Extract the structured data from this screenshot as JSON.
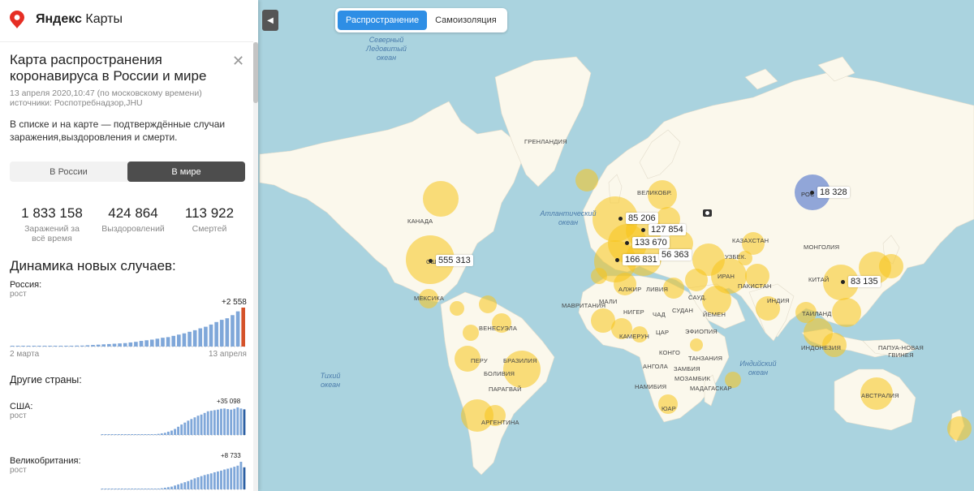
{
  "brand": {
    "name_bold": "Яндекс",
    "name": "Карты",
    "icon": "yandex-maps-pin-icon"
  },
  "panel": {
    "title": "Карта распространения коронавируса в России и мире",
    "close_icon": "✕",
    "date": "13 апреля 2020,10:47 (по московскому времени)",
    "sources": "источники: Роспотребнадзор,JHU",
    "description": "В списке и на карте — подтверждённые случаи заражения,выздоровления и смерти.",
    "segment": {
      "russia": "В России",
      "world": "В мире",
      "selected": "world"
    },
    "stats": [
      {
        "value": "1 833 158",
        "label": "Заражений за всё время"
      },
      {
        "value": "424 864",
        "label": "Выздоровлений"
      },
      {
        "value": "113 922",
        "label": "Смертей"
      }
    ],
    "dynamics_title": "Динамика новых случаев:",
    "other_countries": "Другие страны:"
  },
  "chart_data": [
    {
      "type": "bar",
      "label": "Россия:",
      "sublabel": "рост",
      "last_value_label": "+2 558",
      "x_start": "2 марта",
      "x_end": "13 апреля",
      "color": "#7fa7d9",
      "highlight_color": "#d4522a",
      "values": [
        0,
        0,
        0,
        0,
        0,
        0,
        0,
        0,
        1,
        1,
        1,
        2,
        3,
        3,
        4,
        5,
        6,
        7,
        8,
        9,
        10,
        11,
        13,
        15,
        18,
        20,
        22,
        25,
        28,
        30,
        34,
        38,
        42,
        47,
        52,
        58,
        63,
        70,
        78,
        85,
        90,
        100,
        112,
        124
      ]
    },
    {
      "type": "bar",
      "label": "США:",
      "sublabel": "рост",
      "last_value_label": "+35 098",
      "color": "#7fa7d9",
      "highlight_color": "#2c5fa3",
      "values": [
        0,
        0,
        0,
        0,
        0,
        0,
        0,
        0,
        0,
        0,
        0,
        0,
        0,
        1,
        1,
        2,
        3,
        4,
        6,
        8,
        12,
        16,
        22,
        30,
        38,
        45,
        52,
        58,
        64,
        70,
        74,
        80,
        86,
        88,
        90,
        92,
        95,
        96,
        94,
        92,
        95,
        100,
        96,
        93
      ]
    },
    {
      "type": "bar",
      "label": "Великобритания:",
      "sublabel": "рост",
      "last_value_label": "+8 733",
      "color": "#7fa7d9",
      "highlight_color": "#2c5fa3",
      "values": [
        0,
        0,
        0,
        0,
        0,
        0,
        0,
        0,
        0,
        0,
        0,
        0,
        0,
        0,
        1,
        1,
        2,
        3,
        4,
        6,
        8,
        10,
        14,
        18,
        22,
        26,
        30,
        35,
        40,
        44,
        48,
        52,
        55,
        58,
        62,
        65,
        68,
        72,
        75,
        78,
        82,
        86,
        100,
        80
      ]
    }
  ],
  "map": {
    "tabs": {
      "spread": "Распространение",
      "isolation": "Самоизоляция",
      "selected": "spread"
    },
    "collapse_icon": "◀",
    "colors": {
      "water": "#aad3df",
      "land": "#fbf8ec",
      "bubble": "#f8c51a",
      "russia_bubble": "#7e98d5"
    },
    "callouts": [
      "18 328",
      "85 206",
      "127 854",
      "133 670",
      "166 831",
      "56 363",
      "555 313",
      "83 135"
    ],
    "seas": [
      {
        "text": "Северный Ледовитый океан"
      },
      {
        "text": "Атлантический океан"
      },
      {
        "text": "Тихий океан"
      },
      {
        "text": "Индийский океан"
      }
    ],
    "countries": [
      "ГРЕНЛАНДИЯ",
      "КАНАДА",
      "США",
      "МЕКСИКА",
      "ВЕНЕСУЭЛА",
      "ПЕРУ",
      "БРАЗИЛИЯ",
      "БОЛИВИЯ",
      "ПАРАГВАЙ",
      "АРГЕНТИНА",
      "МАВРИТАНИЯ",
      "МАЛИ",
      "НИГЕР",
      "ЧАД",
      "СУДАН",
      "ЛИВИЯ",
      "АЛЖИР",
      "ЭФИОПИЯ",
      "КАМЕРУН",
      "ЦАР",
      "КОНГО",
      "ТАНЗАНИЯ",
      "АНГОЛА",
      "ЗАМБИЯ",
      "МОЗАМБИК",
      "НАМИБИЯ",
      "ЮАР",
      "МАДАГАСКАР",
      "ЙЕМЕН",
      "САУД.",
      "ИРАН",
      "ИНДИЯ",
      "ПАКИСТАН",
      "КАЗАХСТАН",
      "УЗБЕК.",
      "МОНГОЛИЯ",
      "КИТАЙ",
      "ТАИЛАНД",
      "ИНДОНЕЗИЯ",
      "ПАПУА-НОВАЯ ГВИНЕЯ",
      "АВСТРАЛИЯ",
      "ВЕЛИКОБР.",
      "РОС"
    ]
  }
}
